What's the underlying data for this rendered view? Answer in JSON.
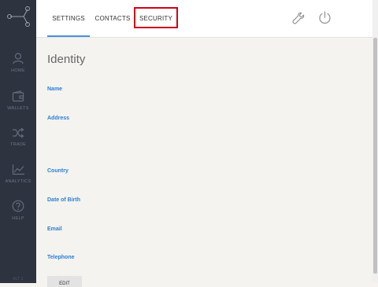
{
  "sidebar": {
    "items": [
      {
        "label": "HOME",
        "icon": "user-icon"
      },
      {
        "label": "WALLETS",
        "icon": "wallet-icon"
      },
      {
        "label": "TRADE",
        "icon": "shuffle-icon"
      },
      {
        "label": "ANALYTICS",
        "icon": "chart-icon"
      },
      {
        "label": "HELP",
        "icon": "help-icon"
      }
    ],
    "footer": "ALT 1"
  },
  "tabs": [
    {
      "label": "SETTINGS",
      "active": true
    },
    {
      "label": "CONTACTS",
      "active": false
    },
    {
      "label": "SECURITY",
      "active": false,
      "highlighted": true
    }
  ],
  "toolbar": {
    "icons": [
      "wrench-icon",
      "power-icon"
    ]
  },
  "main": {
    "title": "Identity",
    "fields": [
      "Name",
      "Address",
      "Country",
      "Date of Birth",
      "Email",
      "Telephone"
    ],
    "edit_label": "EDIT"
  },
  "colors": {
    "sidebar_bg": "#2e3340",
    "accent": "#4a90d9",
    "label_blue": "#2a7fd4",
    "highlight": "#d0021b"
  }
}
